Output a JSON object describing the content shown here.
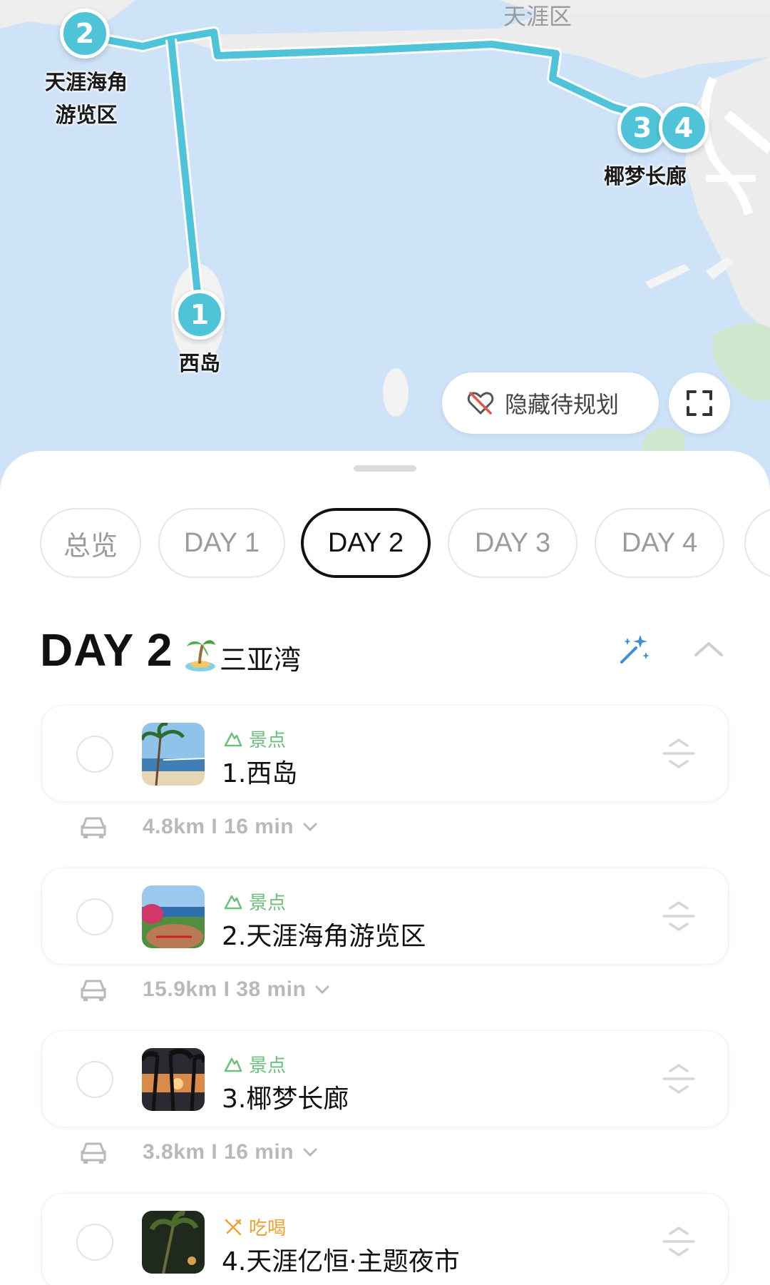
{
  "map": {
    "district_label": "天涯区",
    "markers": [
      {
        "num": "1",
        "label": "西岛"
      },
      {
        "num": "2",
        "label_line1": "天涯海角",
        "label_line2": "游览区"
      },
      {
        "num": "3",
        "label": "椰梦长廊"
      },
      {
        "num": "4"
      }
    ],
    "hide_button_label": "隐藏待规划",
    "route_color": "#4fc4d8",
    "water_color": "#cfe3f8"
  },
  "tabs": [
    {
      "label": "总览",
      "active": false
    },
    {
      "label": "DAY 1",
      "active": false
    },
    {
      "label": "DAY 2",
      "active": true
    },
    {
      "label": "DAY 3",
      "active": false
    },
    {
      "label": "DAY 4",
      "active": false
    }
  ],
  "day": {
    "title": "DAY 2",
    "emoji_icon": "palm-island-icon",
    "place": "三亚湾"
  },
  "items": [
    {
      "category": "景点",
      "category_type": "sight",
      "name": "1.西岛"
    },
    {
      "category": "景点",
      "category_type": "sight",
      "name": "2.天涯海角游览区"
    },
    {
      "category": "景点",
      "category_type": "sight",
      "name": "3.椰梦长廊"
    },
    {
      "category": "吃喝",
      "category_type": "food",
      "name": "4.天涯亿恒·主题夜市"
    }
  ],
  "routes": [
    {
      "text": "4.8km  I  16 min"
    },
    {
      "text": "15.9km  I  38 min"
    },
    {
      "text": "3.8km  I  16 min"
    }
  ],
  "colors": {
    "sight": "#6dbf7c",
    "food": "#f0a12d",
    "marker": "#4fc4d8"
  }
}
